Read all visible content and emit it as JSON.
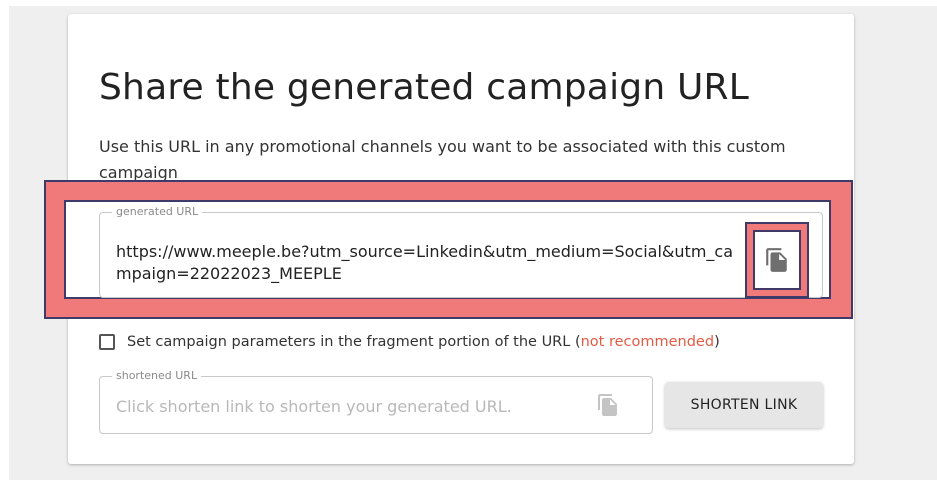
{
  "header": {
    "title": "Share the generated campaign URL",
    "description": "Use this URL in any promotional channels you want to be associated with this custom campaign"
  },
  "generated_url": {
    "legend": "generated URL",
    "value": "https://www.meeple.be?utm_source=Linkedin&utm_medium=Social&utm_campaign=22022023_MEEPLE",
    "copy_icon": "copy-icon"
  },
  "fragment_option": {
    "checked": false,
    "label": "Set campaign parameters in the fragment portion of the URL (",
    "warning": "not recommended",
    "close_paren": ")"
  },
  "shortened_url": {
    "legend": "shortened URL",
    "placeholder": "Click shorten link to shorten your generated URL.",
    "copy_icon": "copy-icon"
  },
  "actions": {
    "shorten_label": "SHORTEN LINK"
  },
  "colors": {
    "highlight": "#f07a7a",
    "highlight_border": "#3e3a6a",
    "warning_text": "#e25b45",
    "background": "#efefef"
  }
}
